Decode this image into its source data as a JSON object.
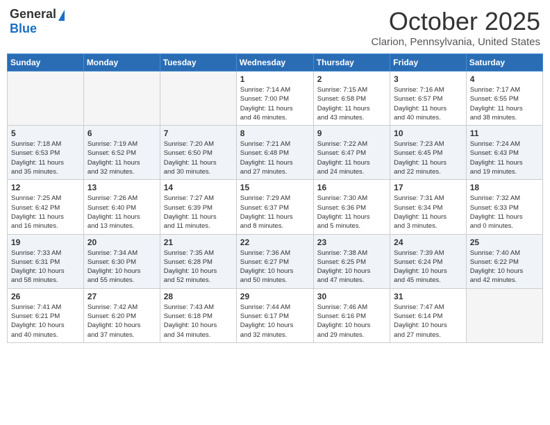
{
  "header": {
    "logo_general": "General",
    "logo_blue": "Blue",
    "month_title": "October 2025",
    "location": "Clarion, Pennsylvania, United States"
  },
  "weekdays": [
    "Sunday",
    "Monday",
    "Tuesday",
    "Wednesday",
    "Thursday",
    "Friday",
    "Saturday"
  ],
  "weeks": [
    {
      "days": [
        {
          "num": "",
          "info": ""
        },
        {
          "num": "",
          "info": ""
        },
        {
          "num": "",
          "info": ""
        },
        {
          "num": "1",
          "info": "Sunrise: 7:14 AM\nSunset: 7:00 PM\nDaylight: 11 hours\nand 46 minutes."
        },
        {
          "num": "2",
          "info": "Sunrise: 7:15 AM\nSunset: 6:58 PM\nDaylight: 11 hours\nand 43 minutes."
        },
        {
          "num": "3",
          "info": "Sunrise: 7:16 AM\nSunset: 6:57 PM\nDaylight: 11 hours\nand 40 minutes."
        },
        {
          "num": "4",
          "info": "Sunrise: 7:17 AM\nSunset: 6:55 PM\nDaylight: 11 hours\nand 38 minutes."
        }
      ]
    },
    {
      "days": [
        {
          "num": "5",
          "info": "Sunrise: 7:18 AM\nSunset: 6:53 PM\nDaylight: 11 hours\nand 35 minutes."
        },
        {
          "num": "6",
          "info": "Sunrise: 7:19 AM\nSunset: 6:52 PM\nDaylight: 11 hours\nand 32 minutes."
        },
        {
          "num": "7",
          "info": "Sunrise: 7:20 AM\nSunset: 6:50 PM\nDaylight: 11 hours\nand 30 minutes."
        },
        {
          "num": "8",
          "info": "Sunrise: 7:21 AM\nSunset: 6:48 PM\nDaylight: 11 hours\nand 27 minutes."
        },
        {
          "num": "9",
          "info": "Sunrise: 7:22 AM\nSunset: 6:47 PM\nDaylight: 11 hours\nand 24 minutes."
        },
        {
          "num": "10",
          "info": "Sunrise: 7:23 AM\nSunset: 6:45 PM\nDaylight: 11 hours\nand 22 minutes."
        },
        {
          "num": "11",
          "info": "Sunrise: 7:24 AM\nSunset: 6:43 PM\nDaylight: 11 hours\nand 19 minutes."
        }
      ]
    },
    {
      "days": [
        {
          "num": "12",
          "info": "Sunrise: 7:25 AM\nSunset: 6:42 PM\nDaylight: 11 hours\nand 16 minutes."
        },
        {
          "num": "13",
          "info": "Sunrise: 7:26 AM\nSunset: 6:40 PM\nDaylight: 11 hours\nand 13 minutes."
        },
        {
          "num": "14",
          "info": "Sunrise: 7:27 AM\nSunset: 6:39 PM\nDaylight: 11 hours\nand 11 minutes."
        },
        {
          "num": "15",
          "info": "Sunrise: 7:29 AM\nSunset: 6:37 PM\nDaylight: 11 hours\nand 8 minutes."
        },
        {
          "num": "16",
          "info": "Sunrise: 7:30 AM\nSunset: 6:36 PM\nDaylight: 11 hours\nand 5 minutes."
        },
        {
          "num": "17",
          "info": "Sunrise: 7:31 AM\nSunset: 6:34 PM\nDaylight: 11 hours\nand 3 minutes."
        },
        {
          "num": "18",
          "info": "Sunrise: 7:32 AM\nSunset: 6:33 PM\nDaylight: 11 hours\nand 0 minutes."
        }
      ]
    },
    {
      "days": [
        {
          "num": "19",
          "info": "Sunrise: 7:33 AM\nSunset: 6:31 PM\nDaylight: 10 hours\nand 58 minutes."
        },
        {
          "num": "20",
          "info": "Sunrise: 7:34 AM\nSunset: 6:30 PM\nDaylight: 10 hours\nand 55 minutes."
        },
        {
          "num": "21",
          "info": "Sunrise: 7:35 AM\nSunset: 6:28 PM\nDaylight: 10 hours\nand 52 minutes."
        },
        {
          "num": "22",
          "info": "Sunrise: 7:36 AM\nSunset: 6:27 PM\nDaylight: 10 hours\nand 50 minutes."
        },
        {
          "num": "23",
          "info": "Sunrise: 7:38 AM\nSunset: 6:25 PM\nDaylight: 10 hours\nand 47 minutes."
        },
        {
          "num": "24",
          "info": "Sunrise: 7:39 AM\nSunset: 6:24 PM\nDaylight: 10 hours\nand 45 minutes."
        },
        {
          "num": "25",
          "info": "Sunrise: 7:40 AM\nSunset: 6:22 PM\nDaylight: 10 hours\nand 42 minutes."
        }
      ]
    },
    {
      "days": [
        {
          "num": "26",
          "info": "Sunrise: 7:41 AM\nSunset: 6:21 PM\nDaylight: 10 hours\nand 40 minutes."
        },
        {
          "num": "27",
          "info": "Sunrise: 7:42 AM\nSunset: 6:20 PM\nDaylight: 10 hours\nand 37 minutes."
        },
        {
          "num": "28",
          "info": "Sunrise: 7:43 AM\nSunset: 6:18 PM\nDaylight: 10 hours\nand 34 minutes."
        },
        {
          "num": "29",
          "info": "Sunrise: 7:44 AM\nSunset: 6:17 PM\nDaylight: 10 hours\nand 32 minutes."
        },
        {
          "num": "30",
          "info": "Sunrise: 7:46 AM\nSunset: 6:16 PM\nDaylight: 10 hours\nand 29 minutes."
        },
        {
          "num": "31",
          "info": "Sunrise: 7:47 AM\nSunset: 6:14 PM\nDaylight: 10 hours\nand 27 minutes."
        },
        {
          "num": "",
          "info": ""
        }
      ]
    }
  ]
}
